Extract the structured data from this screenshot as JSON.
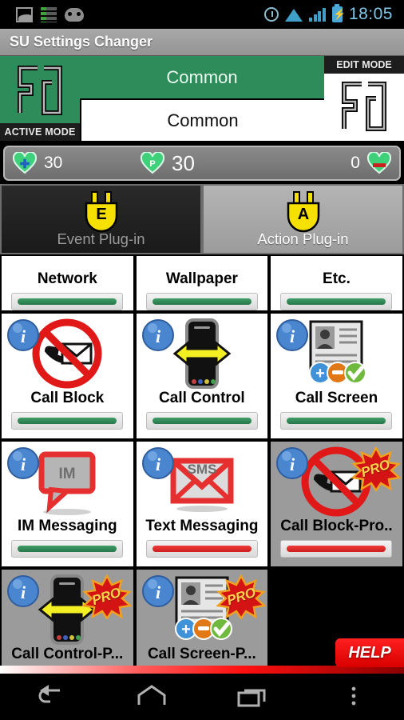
{
  "status_bar": {
    "left_icons": [
      "image-icon",
      "equalizer-icon",
      "android-head-icon"
    ],
    "right_icons": [
      "alarm-icon",
      "wifi-icon",
      "signal-icon",
      "battery-charging-icon"
    ],
    "time": "18:05"
  },
  "title_bar": {
    "app_title": "SU Settings Changer"
  },
  "mode_header": {
    "active_mode_label": "ACTIVE MODE",
    "edit_mode_label": "EDIT MODE",
    "active_mode_value": "Common",
    "edit_mode_value": "Common",
    "logo_icon": "su-logo-icon",
    "accent_green": "#2e8b5a"
  },
  "counter_bar": {
    "enabled_icon": "heart-plus-icon",
    "enabled_count": "30",
    "pro_icon": "heart-pro-icon",
    "pro_count": "30",
    "disabled_count": "0",
    "disabled_icon": "heart-minus-icon"
  },
  "tabs": [
    {
      "label": "Event Plug-in",
      "icon": "plug-e-icon",
      "selected": true
    },
    {
      "label": "Action Plug-in",
      "icon": "plug-a-icon",
      "selected": false
    }
  ],
  "grid": {
    "rows": [
      {
        "clipped": "top",
        "cells": [
          {
            "name": "Network",
            "icon": "network-icon",
            "bar": "green",
            "pro": false,
            "dim": false
          },
          {
            "name": "Wallpaper",
            "icon": "wallpaper-icon",
            "bar": "green",
            "pro": false,
            "dim": false
          },
          {
            "name": "Etc.",
            "icon": "gear-icon",
            "bar": "green",
            "pro": false,
            "dim": false
          }
        ]
      },
      {
        "cells": [
          {
            "name": "Call Block",
            "icon": "call-block-icon",
            "bar": "green",
            "pro": false,
            "dim": false
          },
          {
            "name": "Call Control",
            "icon": "call-control-icon",
            "bar": "green",
            "pro": false,
            "dim": false
          },
          {
            "name": "Call Screen",
            "icon": "call-screen-icon",
            "bar": "green",
            "pro": false,
            "dim": false
          }
        ]
      },
      {
        "cells": [
          {
            "name": "IM Messaging",
            "icon": "im-bubble-icon",
            "bar": "green",
            "pro": false,
            "dim": false
          },
          {
            "name": "Text Messaging",
            "icon": "sms-icon",
            "bar": "red",
            "pro": false,
            "dim": false
          },
          {
            "name": "Call Block-Pro..",
            "icon": "call-block-icon",
            "bar": "red",
            "pro": true,
            "dim": true
          }
        ]
      },
      {
        "clipped": "bottom",
        "cells": [
          {
            "name": "Call Control-P...",
            "icon": "call-control-icon",
            "bar": "red",
            "pro": true,
            "dim": true
          },
          {
            "name": "Call Screen-P...",
            "icon": "call-screen-icon",
            "bar": "red",
            "pro": true,
            "dim": true
          }
        ]
      }
    ],
    "pro_badge_label": "PRO"
  },
  "help_button": {
    "label": "HELP"
  },
  "nav_bar": {
    "buttons": [
      {
        "icon": "back-icon"
      },
      {
        "icon": "home-icon"
      },
      {
        "icon": "recents-icon"
      },
      {
        "icon": "overflow-menu-icon"
      }
    ]
  }
}
